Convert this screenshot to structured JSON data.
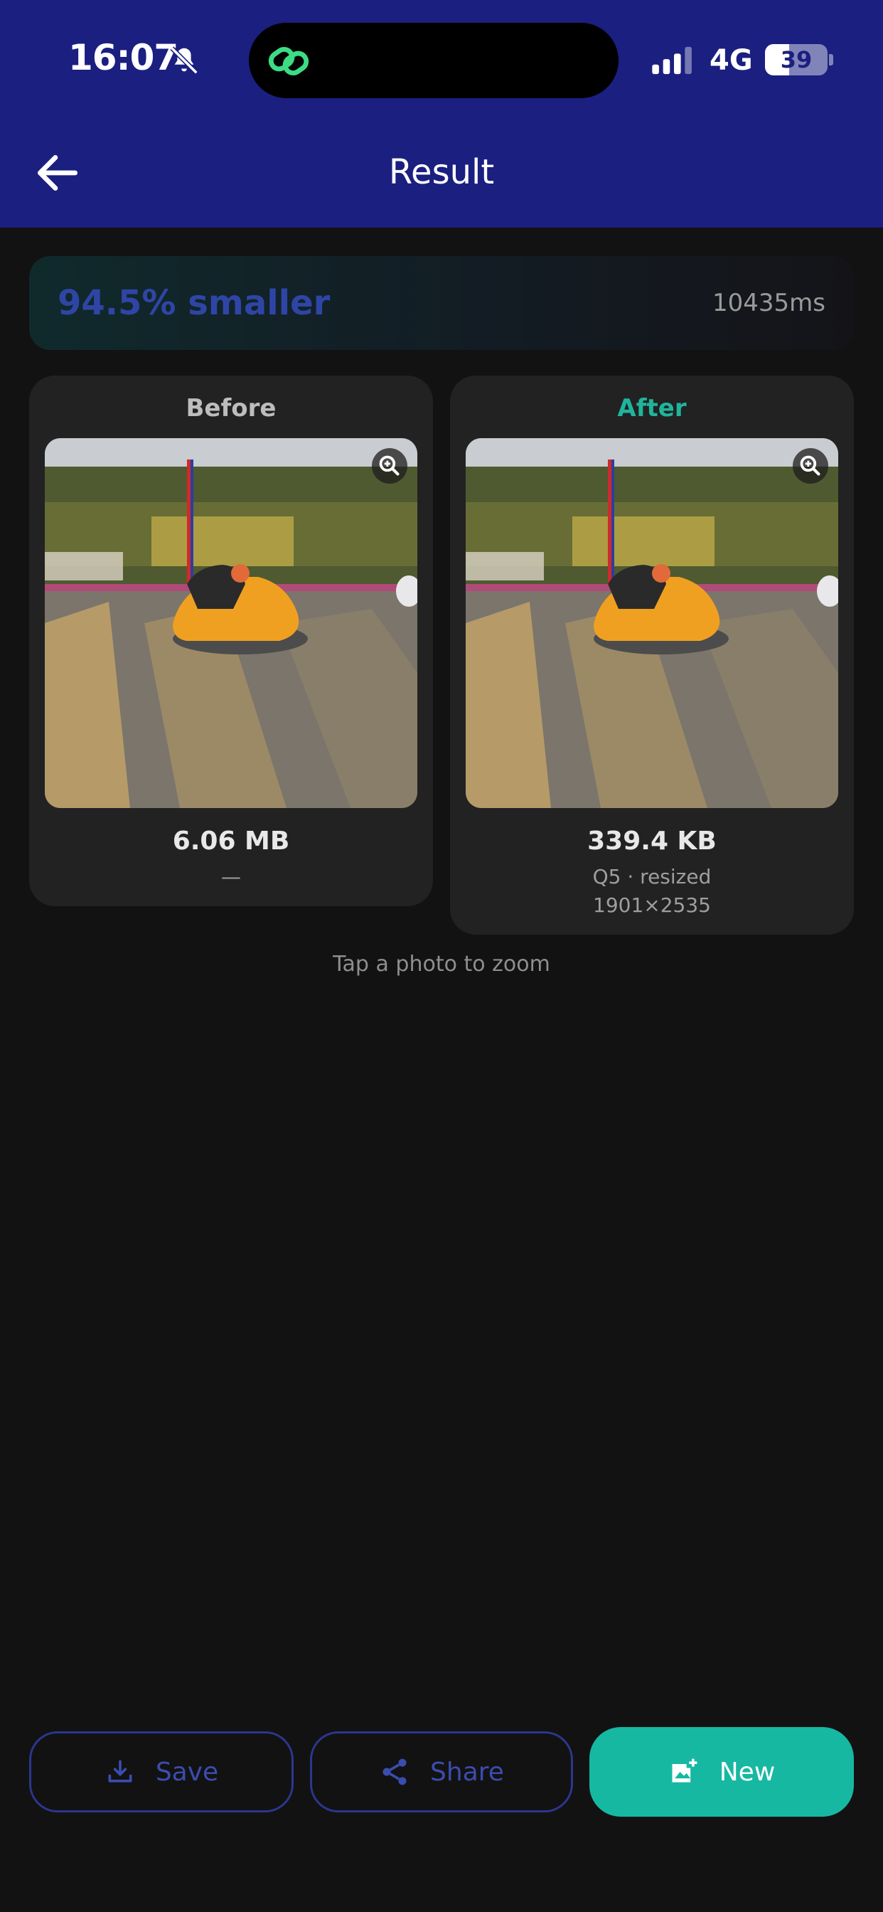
{
  "status_bar": {
    "time": "16:07",
    "network": "4G",
    "battery": "39",
    "battery_level": 0.39,
    "icons": [
      "bell-off-icon",
      "link-icon",
      "signal-icon",
      "battery-icon"
    ]
  },
  "app_bar": {
    "title": "Result",
    "back_icon": "arrow-left-icon",
    "background": "#1b1f80"
  },
  "summary": {
    "savings": "94.5% smaller",
    "elapsed": "10435ms"
  },
  "before": {
    "heading": "Before",
    "size": "6.06 MB",
    "detail": "—"
  },
  "after": {
    "heading": "After",
    "size": "339.4 KB",
    "detail": "Q5 · resized",
    "dimensions": "1901×2535"
  },
  "hint": "Tap a photo to zoom",
  "actions": {
    "save": "Save",
    "share": "Share",
    "new": "New"
  },
  "colors": {
    "accent": "#17b8a2",
    "primary": "#1b1f80",
    "outline": "#2c3690",
    "background": "#121212",
    "card": "#222222"
  }
}
